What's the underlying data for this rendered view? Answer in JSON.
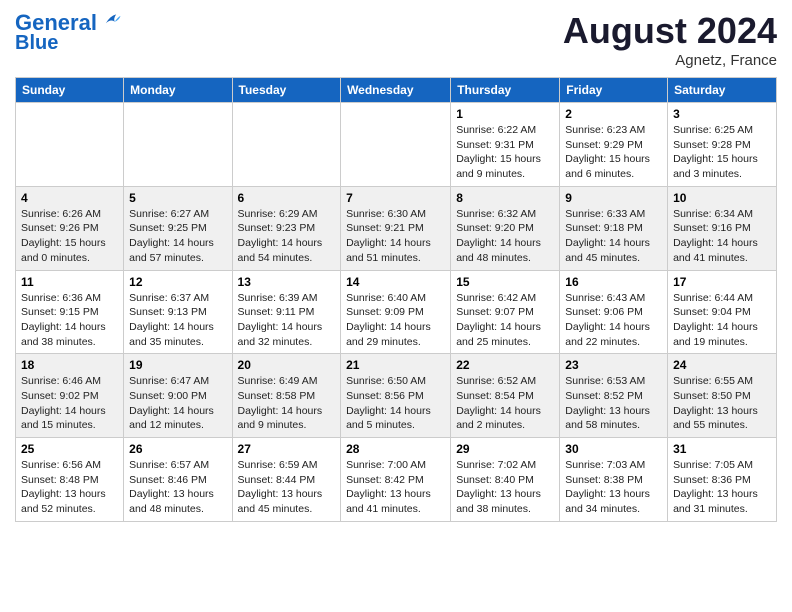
{
  "logo": {
    "line1": "General",
    "line2": "Blue"
  },
  "header": {
    "month": "August 2024",
    "location": "Agnetz, France"
  },
  "weekdays": [
    "Sunday",
    "Monday",
    "Tuesday",
    "Wednesday",
    "Thursday",
    "Friday",
    "Saturday"
  ],
  "weeks": [
    [
      {
        "day": "",
        "info": ""
      },
      {
        "day": "",
        "info": ""
      },
      {
        "day": "",
        "info": ""
      },
      {
        "day": "",
        "info": ""
      },
      {
        "day": "1",
        "info": "Sunrise: 6:22 AM\nSunset: 9:31 PM\nDaylight: 15 hours\nand 9 minutes."
      },
      {
        "day": "2",
        "info": "Sunrise: 6:23 AM\nSunset: 9:29 PM\nDaylight: 15 hours\nand 6 minutes."
      },
      {
        "day": "3",
        "info": "Sunrise: 6:25 AM\nSunset: 9:28 PM\nDaylight: 15 hours\nand 3 minutes."
      }
    ],
    [
      {
        "day": "4",
        "info": "Sunrise: 6:26 AM\nSunset: 9:26 PM\nDaylight: 15 hours\nand 0 minutes."
      },
      {
        "day": "5",
        "info": "Sunrise: 6:27 AM\nSunset: 9:25 PM\nDaylight: 14 hours\nand 57 minutes."
      },
      {
        "day": "6",
        "info": "Sunrise: 6:29 AM\nSunset: 9:23 PM\nDaylight: 14 hours\nand 54 minutes."
      },
      {
        "day": "7",
        "info": "Sunrise: 6:30 AM\nSunset: 9:21 PM\nDaylight: 14 hours\nand 51 minutes."
      },
      {
        "day": "8",
        "info": "Sunrise: 6:32 AM\nSunset: 9:20 PM\nDaylight: 14 hours\nand 48 minutes."
      },
      {
        "day": "9",
        "info": "Sunrise: 6:33 AM\nSunset: 9:18 PM\nDaylight: 14 hours\nand 45 minutes."
      },
      {
        "day": "10",
        "info": "Sunrise: 6:34 AM\nSunset: 9:16 PM\nDaylight: 14 hours\nand 41 minutes."
      }
    ],
    [
      {
        "day": "11",
        "info": "Sunrise: 6:36 AM\nSunset: 9:15 PM\nDaylight: 14 hours\nand 38 minutes."
      },
      {
        "day": "12",
        "info": "Sunrise: 6:37 AM\nSunset: 9:13 PM\nDaylight: 14 hours\nand 35 minutes."
      },
      {
        "day": "13",
        "info": "Sunrise: 6:39 AM\nSunset: 9:11 PM\nDaylight: 14 hours\nand 32 minutes."
      },
      {
        "day": "14",
        "info": "Sunrise: 6:40 AM\nSunset: 9:09 PM\nDaylight: 14 hours\nand 29 minutes."
      },
      {
        "day": "15",
        "info": "Sunrise: 6:42 AM\nSunset: 9:07 PM\nDaylight: 14 hours\nand 25 minutes."
      },
      {
        "day": "16",
        "info": "Sunrise: 6:43 AM\nSunset: 9:06 PM\nDaylight: 14 hours\nand 22 minutes."
      },
      {
        "day": "17",
        "info": "Sunrise: 6:44 AM\nSunset: 9:04 PM\nDaylight: 14 hours\nand 19 minutes."
      }
    ],
    [
      {
        "day": "18",
        "info": "Sunrise: 6:46 AM\nSunset: 9:02 PM\nDaylight: 14 hours\nand 15 minutes."
      },
      {
        "day": "19",
        "info": "Sunrise: 6:47 AM\nSunset: 9:00 PM\nDaylight: 14 hours\nand 12 minutes."
      },
      {
        "day": "20",
        "info": "Sunrise: 6:49 AM\nSunset: 8:58 PM\nDaylight: 14 hours\nand 9 minutes."
      },
      {
        "day": "21",
        "info": "Sunrise: 6:50 AM\nSunset: 8:56 PM\nDaylight: 14 hours\nand 5 minutes."
      },
      {
        "day": "22",
        "info": "Sunrise: 6:52 AM\nSunset: 8:54 PM\nDaylight: 14 hours\nand 2 minutes."
      },
      {
        "day": "23",
        "info": "Sunrise: 6:53 AM\nSunset: 8:52 PM\nDaylight: 13 hours\nand 58 minutes."
      },
      {
        "day": "24",
        "info": "Sunrise: 6:55 AM\nSunset: 8:50 PM\nDaylight: 13 hours\nand 55 minutes."
      }
    ],
    [
      {
        "day": "25",
        "info": "Sunrise: 6:56 AM\nSunset: 8:48 PM\nDaylight: 13 hours\nand 52 minutes."
      },
      {
        "day": "26",
        "info": "Sunrise: 6:57 AM\nSunset: 8:46 PM\nDaylight: 13 hours\nand 48 minutes."
      },
      {
        "day": "27",
        "info": "Sunrise: 6:59 AM\nSunset: 8:44 PM\nDaylight: 13 hours\nand 45 minutes."
      },
      {
        "day": "28",
        "info": "Sunrise: 7:00 AM\nSunset: 8:42 PM\nDaylight: 13 hours\nand 41 minutes."
      },
      {
        "day": "29",
        "info": "Sunrise: 7:02 AM\nSunset: 8:40 PM\nDaylight: 13 hours\nand 38 minutes."
      },
      {
        "day": "30",
        "info": "Sunrise: 7:03 AM\nSunset: 8:38 PM\nDaylight: 13 hours\nand 34 minutes."
      },
      {
        "day": "31",
        "info": "Sunrise: 7:05 AM\nSunset: 8:36 PM\nDaylight: 13 hours\nand 31 minutes."
      }
    ]
  ]
}
